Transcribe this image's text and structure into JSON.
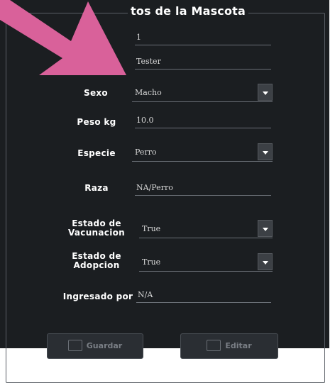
{
  "form": {
    "title": "tos de la Mascota",
    "id_value": "1",
    "name_value": "Tester",
    "sexo_label": "Sexo",
    "sexo_value": "Macho",
    "peso_label": "Peso kg",
    "peso_value": "10.0",
    "especie_label": "Especie",
    "especie_value": "Perro",
    "raza_label": "Raza",
    "raza_value": "NA/Perro",
    "vacunacion_label_line1": "Estado de",
    "vacunacion_label_line2": "Vacunacion",
    "vacunacion_value": "True",
    "adopcion_label_line1": "Estado de",
    "adopcion_label_line2": "Adopcion",
    "adopcion_value": "True",
    "ingresado_label": "Ingresado por",
    "ingresado_value": "N/A"
  },
  "buttons": {
    "guardar_label": "Guardar",
    "editar_label": "Editar"
  },
  "overlay": {
    "arrow_color": "#d9619a",
    "arrow_icon": "pointer-arrow-icon"
  },
  "colors": {
    "window_bg": "#1b1e21",
    "text": "#ffffff",
    "field_text": "#d8d8d8"
  }
}
